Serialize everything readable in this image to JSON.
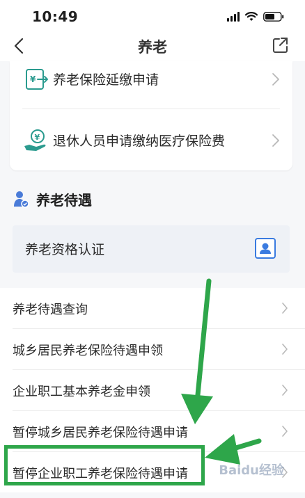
{
  "status": {
    "time": "10:49"
  },
  "nav": {
    "title": "养老"
  },
  "top_card": {
    "items": [
      {
        "label": "养老保险延缴申请",
        "icon": "money-transfer-icon"
      },
      {
        "label": "退休人员申请缴纳医疗保险费",
        "icon": "hand-coin-icon"
      }
    ]
  },
  "section": {
    "title": "养老待遇",
    "icon": "elderly-person-icon"
  },
  "qualification": {
    "label": "养老资格认证",
    "icon": "id-card-icon"
  },
  "list": {
    "items": [
      {
        "label": "养老待遇查询"
      },
      {
        "label": "城乡居民养老保险待遇申领"
      },
      {
        "label": "企业职工基本养老金申领"
      },
      {
        "label": "暂停城乡居民养老保险待遇申请"
      },
      {
        "label": "暂停企业职工养老保险待遇申请"
      }
    ]
  },
  "annotation": {
    "highlight_color": "#2ea64a"
  },
  "watermark": {
    "text": "Baidu经验"
  },
  "colors": {
    "accent": "#2b9b8f",
    "highlight": "#2ea64a",
    "section_icon": "#4a7bd8"
  }
}
